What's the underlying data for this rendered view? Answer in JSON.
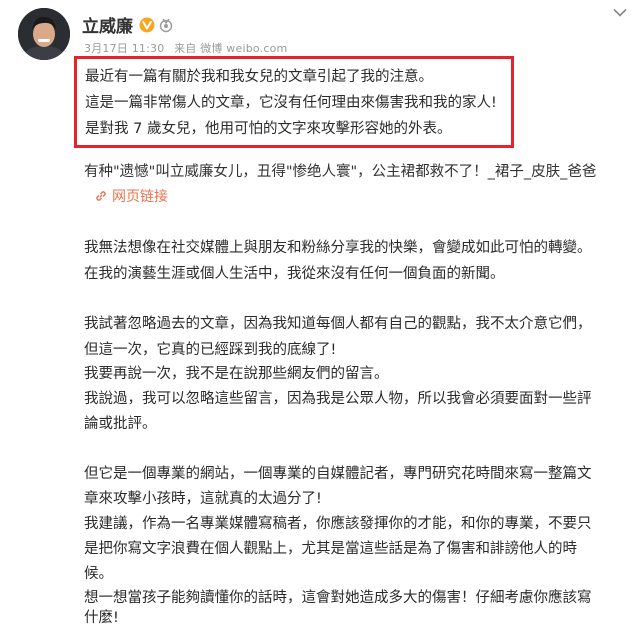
{
  "header": {
    "name": "立威廉",
    "meta_date": "3月17日 11:30",
    "meta_source": "来自 微博 weibo.com"
  },
  "icons": {
    "verified": "vip-badge-icon",
    "medal": "medal-icon",
    "more": "chevron-down-icon",
    "link": "link-icon"
  },
  "colors": {
    "highlight_border": "#e5232a",
    "link": "#eb7350",
    "vip": "#f5a623"
  },
  "highlight": {
    "lines": [
      "最近有一篇有關於我和我女兒的文章引起了我的注意。",
      "這是一篇非常傷人的文章，它沒有任何理由來傷害我和我的家人!",
      "是對我 7 歲女兒，他用可怕的文字來攻擊形容她的外表。"
    ]
  },
  "shared": {
    "text": "有种\"遗憾\"叫立威廉女儿，丑得\"惨绝人寰\"，公主裙都救不了！_裙子_皮肤_爸爸",
    "link_label": "网页链接"
  },
  "body": {
    "lines": [
      "我無法想像在社交媒體上與朋友和粉絲分享我的快樂，會變成如此可怕的轉變。",
      "在我的演藝生涯或個人生活中，我從來沒有任何一個負面的新聞。",
      "我試著忽略過去的文章，因為我知道每個人都有自己的觀點，我不太介意它們，",
      "但這一次，它真的已經踩到我的底線了!",
      "我要再說一次，我不是在說那些網友們的留言。",
      "我說過，我可以忽略這些留言，因為我是公眾人物，所以我會必須要面對一些評",
      "論或批評。",
      "但它是一個專業的網站，一個專業的自媒體記者，專門研究花時間來寫一整篇文",
      "章來攻擊小孩時，這就真的太過分了!",
      "我建議，作為一名專業媒體寫稿者，你應該發揮你的才能，和你的專業，不要只",
      "是把你寫文字浪費在個人觀點上，尤其是當這些話是為了傷害和誹謗他人的時",
      "候。",
      "想一想當孩子能夠讀懂你的話時，這會對她造成多大的傷害！仔細考慮你應該寫",
      "什麼!"
    ]
  }
}
